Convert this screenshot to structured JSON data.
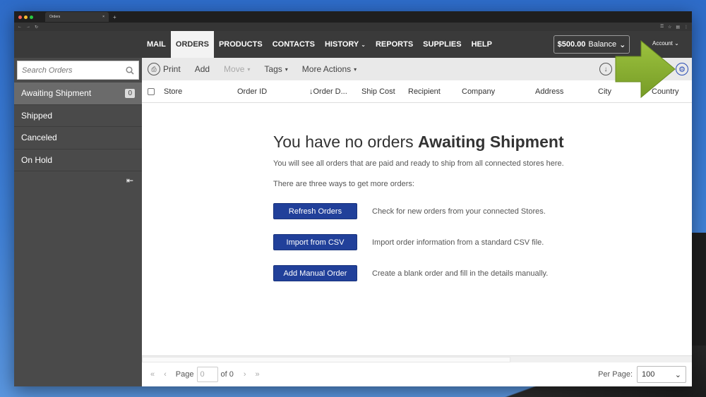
{
  "browser": {
    "tab_title": "Orders",
    "tab_close": "×",
    "new_tab": "+"
  },
  "header": {
    "nav": [
      {
        "label": "MAIL",
        "active": false,
        "dropdown": false
      },
      {
        "label": "ORDERS",
        "active": true,
        "dropdown": false
      },
      {
        "label": "PRODUCTS",
        "active": false,
        "dropdown": false
      },
      {
        "label": "CONTACTS",
        "active": false,
        "dropdown": false
      },
      {
        "label": "HISTORY",
        "active": false,
        "dropdown": true
      },
      {
        "label": "REPORTS",
        "active": false,
        "dropdown": false
      },
      {
        "label": "SUPPLIES",
        "active": false,
        "dropdown": false
      },
      {
        "label": "HELP",
        "active": false,
        "dropdown": false
      }
    ],
    "balance_amount": "$500.00",
    "balance_suffix": "Balance",
    "account_label": "Account"
  },
  "sidebar": {
    "search_placeholder": "Search Orders",
    "items": [
      {
        "label": "Awaiting Shipment",
        "count": "0",
        "active": true
      },
      {
        "label": "Shipped",
        "count": "",
        "active": false
      },
      {
        "label": "Canceled",
        "count": "",
        "active": false
      },
      {
        "label": "On Hold",
        "count": "",
        "active": false
      }
    ]
  },
  "toolbar": {
    "print": "Print",
    "add": "Add",
    "move": "Move",
    "tags": "Tags",
    "more_actions": "More Actions"
  },
  "table": {
    "columns": [
      "Store",
      "Order ID",
      "Order D...",
      "Ship Cost",
      "Recipient",
      "Company",
      "Address",
      "City",
      "Country"
    ]
  },
  "empty_state": {
    "title_prefix": "You have no orders",
    "title_bold": "Awaiting Shipment",
    "line1": "You will see all orders that are paid and ready to ship from all connected stores here.",
    "line2": "There are three ways to get more orders:",
    "actions": [
      {
        "button": "Refresh Orders",
        "desc": "Check for new orders from your connected Stores."
      },
      {
        "button": "Import from CSV",
        "desc": "Import order information from a standard CSV file."
      },
      {
        "button": "Add Manual Order",
        "desc": "Create a blank order and fill in the details manually."
      }
    ]
  },
  "footer": {
    "page_label": "Page",
    "page_value": "0",
    "of_label": "of 0",
    "per_page_label": "Per Page:",
    "per_page_value": "100"
  },
  "colors": {
    "accent_blue": "#21409a",
    "annotation_green": "#8db534",
    "header_bg": "#3a3a3a",
    "sidebar_bg": "#4a4a4a"
  }
}
